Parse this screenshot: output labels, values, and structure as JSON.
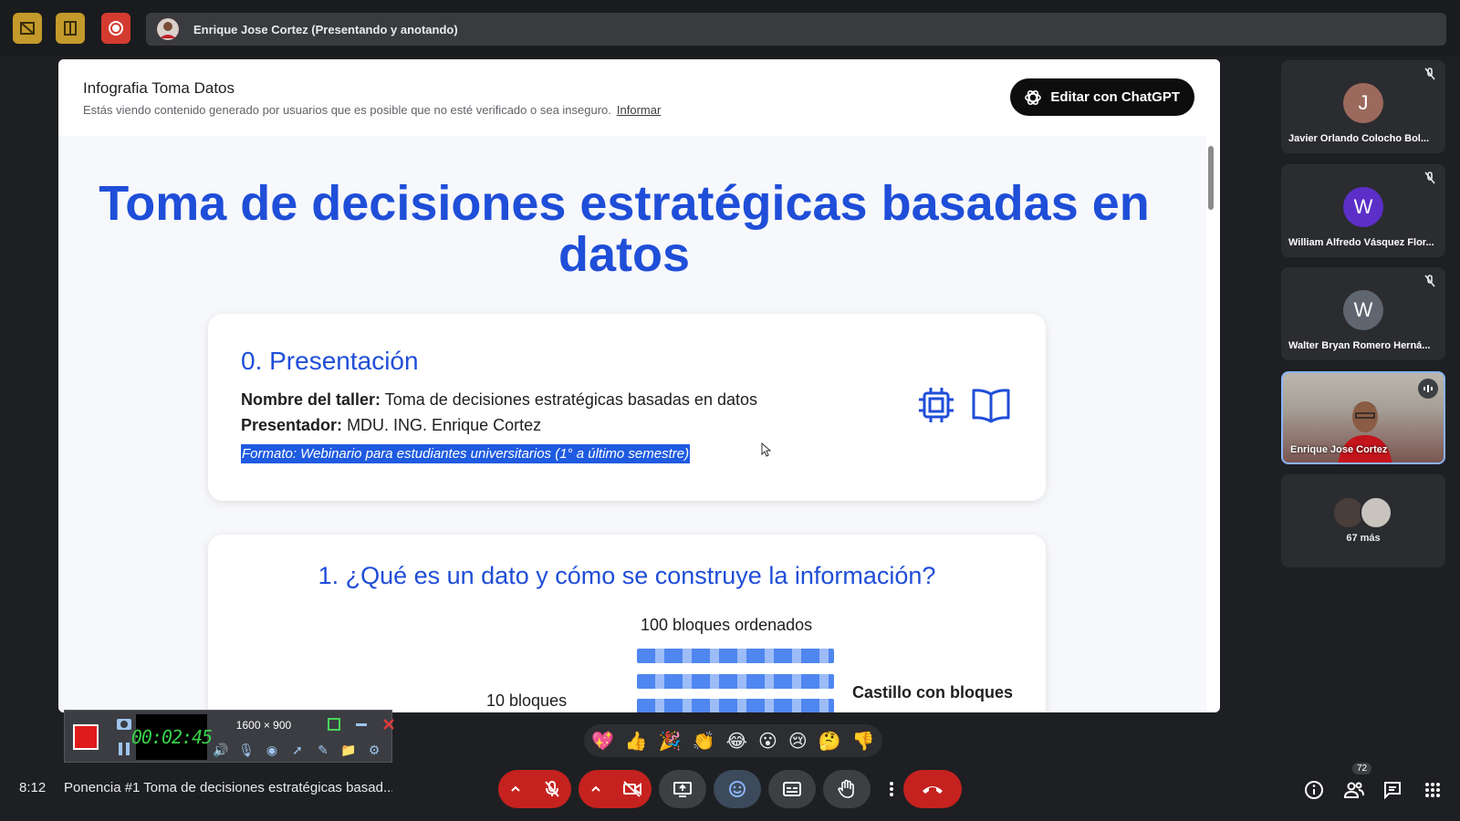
{
  "topbar": {
    "presenter_label": "Enrique Jose Cortez (Presentando y anotando)"
  },
  "doc": {
    "title": "Infografia Toma Datos",
    "warning": "Estás viendo contenido generado por usuarios que es posible que no esté verificado o sea inseguro.",
    "report_link": "Informar",
    "edit_button": "Editar con ChatGPT",
    "main_title": "Toma de decisiones estratégicas basadas en datos",
    "section0": {
      "heading": "0. Presentación",
      "workshop_label": "Nombre del taller:",
      "workshop_value": "Toma de decisiones estratégicas basadas en datos",
      "presenter_label": "Presentador:",
      "presenter_value": "MDU. ING. Enrique Cortez",
      "format": "Formato: Webinario para estudiantes universitarios (1° a último semestre)"
    },
    "section1": {
      "heading": "1. ¿Qué es un dato y cómo se construye la información?",
      "blocks_label": "100 bloques ordenados",
      "ten_blocks": "10 bloques",
      "castle_label": "Castillo con bloques"
    }
  },
  "participants": [
    {
      "initial": "J",
      "name": "Javier Orlando Colocho Bol...",
      "color": "#9c6a5c"
    },
    {
      "initial": "W",
      "name": "William Alfredo Vásquez Flor...",
      "color": "#5b2fc8"
    },
    {
      "initial": "W",
      "name": "Walter Bryan Romero Herná...",
      "color": "#5f6670"
    },
    {
      "name": "Enrique Jose Cortez"
    },
    {
      "more": "67 más"
    }
  ],
  "recorder": {
    "timer": "00:02:45",
    "resolution": "1600 × 900"
  },
  "reactions": [
    "💖",
    "👍",
    "🎉",
    "👏",
    "😂",
    "😮",
    "😢",
    "🤔",
    "👎"
  ],
  "bottom": {
    "time": "8:12",
    "meeting_title": "Ponencia #1 Toma de decisiones estratégicas basad...",
    "participant_count": "72"
  }
}
